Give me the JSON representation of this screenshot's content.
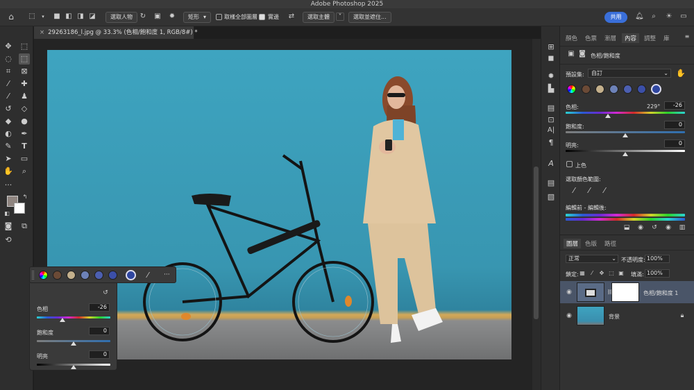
{
  "app": {
    "title": "Adobe Photoshop 2025"
  },
  "options": {
    "select_subject": "選取人物",
    "shape": "矩形",
    "sample_all_label": "取樣全部圖層",
    "hard_edge_label": "實邊",
    "select_and_mask": "選取主體",
    "select_and_mask2": "選取並遮住...",
    "share": "共用"
  },
  "document": {
    "tab": "29263186_l.jpg @ 33.3% (色相/飽和度 1, RGB/8#) *"
  },
  "properties": {
    "tabs": [
      "顏色",
      "色票",
      "漸層",
      "內容",
      "調整",
      "庫"
    ],
    "active_tab": 3,
    "header": "色相/飽和度",
    "preset_label": "預設集:",
    "preset_value": "自訂",
    "swatch_colors": [
      "#6b4a36",
      "#c4b08c",
      "#6d82b8",
      "#4c5fb0",
      "#3b4fa8",
      "#2f46a0"
    ],
    "hue_label": "色相:",
    "hue_value": "229°",
    "hue_box": "-26",
    "sat_label": "飽和度:",
    "sat_value": "0",
    "light_label": "明亮:",
    "light_value": "0",
    "colorize_label": "上色",
    "range_label": "選取顏色範圍:",
    "before_after_label": "編輯前 - 編輯後:"
  },
  "layers": {
    "tabs": [
      "圖層",
      "色版",
      "路徑"
    ],
    "blend_mode": "正常",
    "opacity_label": "不透明度:",
    "opacity_value": "100%",
    "lock_label": "鎖定:",
    "fill_label": "填滿:",
    "fill_value": "100%",
    "items": [
      {
        "name": "色相/飽和度 1"
      },
      {
        "name": "背景"
      }
    ]
  },
  "float": {
    "hue_label": "色相",
    "hue_value": "-26",
    "sat_label": "飽和度",
    "sat_value": "0",
    "light_label": "明亮",
    "light_value": "0",
    "more": "···"
  },
  "colors": {
    "accent": "#3a6fd9",
    "panel": "#323232"
  }
}
